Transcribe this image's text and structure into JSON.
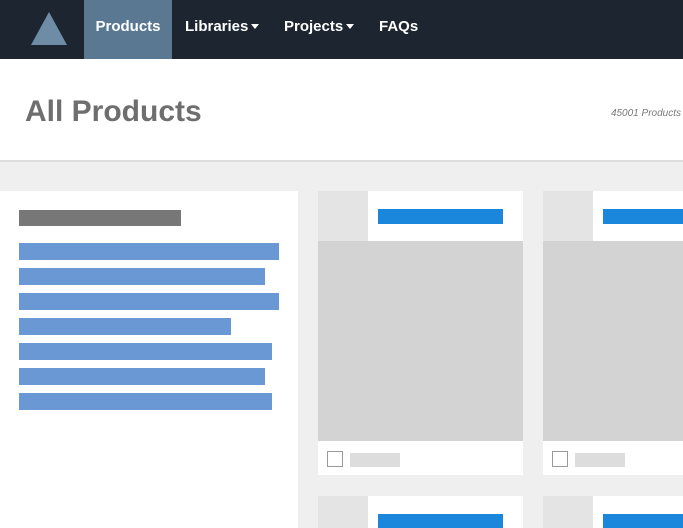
{
  "navbar": {
    "logo_icon": "triangle-logo-icon",
    "items": [
      {
        "label": "Products",
        "active": true,
        "dropdown": false
      },
      {
        "label": "Libraries",
        "active": false,
        "dropdown": true
      },
      {
        "label": "Projects",
        "active": false,
        "dropdown": true
      },
      {
        "label": "FAQs",
        "active": false,
        "dropdown": false
      }
    ]
  },
  "header": {
    "title": "All Products",
    "count": "45001 Products"
  },
  "sidebar": {
    "state": "loading-placeholder",
    "filter_placeholder_count": 7
  },
  "products": {
    "state": "loading-placeholder",
    "visible_card_count": 4
  },
  "colors": {
    "navbar_bg": "#1c2530",
    "nav_active_bg": "#5a7891",
    "accent_blue": "#1a87dd",
    "filter_placeholder": "#6a98d4",
    "page_bg": "#efefef"
  }
}
